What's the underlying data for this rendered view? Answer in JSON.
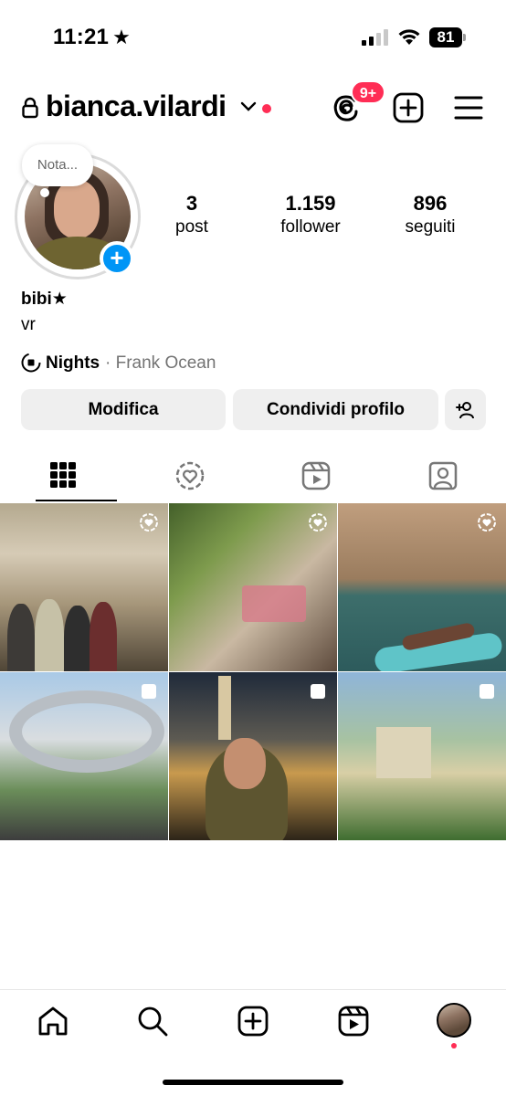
{
  "status_bar": {
    "time": "11:21",
    "focus_icon": "star-icon",
    "battery": "81"
  },
  "header": {
    "username": "bianca.vilardi",
    "notification_badge": "9+",
    "icons": [
      "lock-icon",
      "chevron-down-icon",
      "threads-icon",
      "add-icon",
      "menu-icon"
    ],
    "live_dot_color": "#ff2d55"
  },
  "profile": {
    "note_placeholder": "Nota...",
    "stats": [
      {
        "value": "3",
        "label": "post"
      },
      {
        "value": "1.159",
        "label": "follower"
      },
      {
        "value": "896",
        "label": "seguiti"
      }
    ],
    "display_name": "bibi★",
    "bio": "vr",
    "music": {
      "title": "Nights",
      "separator_artist": "· Frank Ocean"
    },
    "buttons": {
      "edit": "Modifica",
      "share": "Condividi profilo"
    }
  },
  "tabs": [
    "grid-icon",
    "tagged-heart-icon",
    "reels-icon",
    "tagged-person-icon"
  ],
  "grid": {
    "posts": [
      {
        "badge": "heart-circle-icon"
      },
      {
        "badge": "heart-circle-icon"
      },
      {
        "badge": "heart-circle-icon"
      },
      {
        "badge": "square-icon"
      },
      {
        "badge": "square-icon"
      },
      {
        "badge": "square-icon"
      }
    ]
  },
  "bottom_nav": [
    "home-icon",
    "search-icon",
    "create-icon",
    "reels-icon",
    "profile-avatar"
  ],
  "colors": {
    "accent_blue": "#0095f6",
    "badge_red": "#ff2d55",
    "button_gray": "#efefef"
  }
}
